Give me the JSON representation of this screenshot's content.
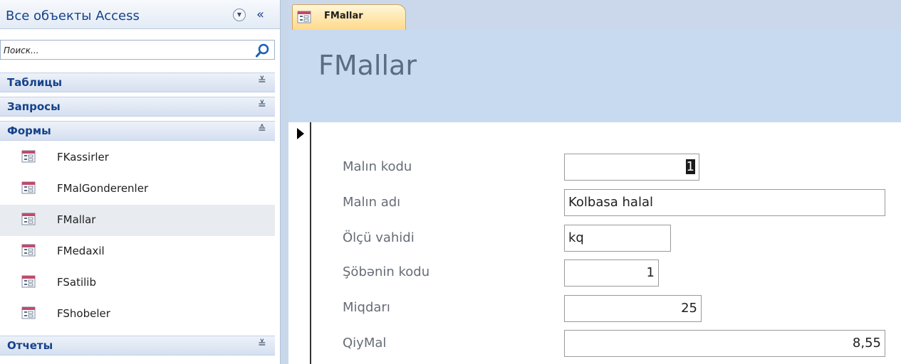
{
  "nav": {
    "title": "Все объекты Access",
    "collapse_symbol": "«",
    "search_placeholder": "Поиск...",
    "groups": {
      "tables": {
        "label": "Таблицы",
        "chevron": "≚"
      },
      "queries": {
        "label": "Запросы",
        "chevron": "≚"
      },
      "forms": {
        "label": "Формы",
        "chevron": "≙"
      },
      "reports": {
        "label": "Отчеты",
        "chevron": "≚"
      }
    },
    "form_items": [
      "FKassirler",
      "FMalGonderenler",
      "FMallar",
      "FMedaxil",
      "FSatilib",
      "FShobeler"
    ],
    "selected_item": "FMallar"
  },
  "tab": {
    "label": "FMallar"
  },
  "form": {
    "title": "FMallar",
    "fields": [
      {
        "label": "Malın kodu",
        "value": "1"
      },
      {
        "label": "Malın adı",
        "value": "Kolbasa halal"
      },
      {
        "label": "Ölçü vahidi",
        "value": "kq"
      },
      {
        "label": "Şöbənin kodu",
        "value": "1"
      },
      {
        "label": "Miqdarı",
        "value": "25"
      },
      {
        "label": "QiyMal",
        "value": "8,55"
      }
    ]
  },
  "colors": {
    "accent": "#15428b",
    "form_header_bg": "#c8daf0",
    "tab_active": "#ffd98a"
  },
  "icons": {
    "form": "form-icon",
    "search": "magnifier-icon",
    "dropdown": "circle-chevron-down-icon",
    "record_selector": "triangle-right-icon"
  }
}
